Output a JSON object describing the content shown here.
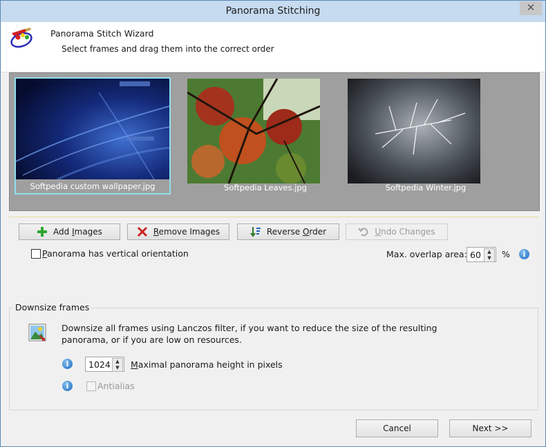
{
  "window": {
    "title": "Panorama Stitching",
    "close_glyph": "✕"
  },
  "header": {
    "title": "Panorama Stitch Wizard",
    "subtitle": "Select frames and drag them into the correct order",
    "logo_icon": "palette-brush-icon"
  },
  "frames": [
    {
      "caption": "Softpedia custom wallpaper.jpg",
      "selected": true,
      "theme": "blue-abstract"
    },
    {
      "caption": "Softpedia Leaves.jpg",
      "selected": false,
      "theme": "autumn-leaves"
    },
    {
      "caption": "Softpedia Winter.jpg",
      "selected": false,
      "theme": "frost-branches"
    }
  ],
  "toolbar": {
    "add_prefix": "Add ",
    "add_key": "I",
    "add_suffix": "mages",
    "remove_key": "R",
    "remove_suffix": "emove Images",
    "reverse_prefix": "Reverse ",
    "reverse_key": "O",
    "reverse_suffix": "rder",
    "undo_key": "U",
    "undo_suffix": "ndo Changes"
  },
  "options": {
    "vertical_key": "P",
    "vertical_suffix": "anorama has vertical orientation",
    "vertical_checked": false,
    "overlap_label": "Max. overlap area:",
    "overlap_value": "60",
    "overlap_unit": "%"
  },
  "downsize": {
    "group_title": "Downsize frames",
    "description_line1": "Downsize all frames using Lanczos filter, if you want to reduce the size of the resulting",
    "description_line2": "panorama, or if you are low on resources.",
    "height_value": "1024",
    "height_key": "M",
    "height_suffix": "aximal panorama height in pixels",
    "antialias_label": "Antialias",
    "antialias_checked": false,
    "info_glyph": "i"
  },
  "footer": {
    "cancel_label": "Cancel",
    "next_label": "Next >>"
  },
  "colors": {
    "accent_selection": "#8ee0ee",
    "title_bar": "#c6daf0",
    "frames_bg": "#9f9f9f"
  }
}
